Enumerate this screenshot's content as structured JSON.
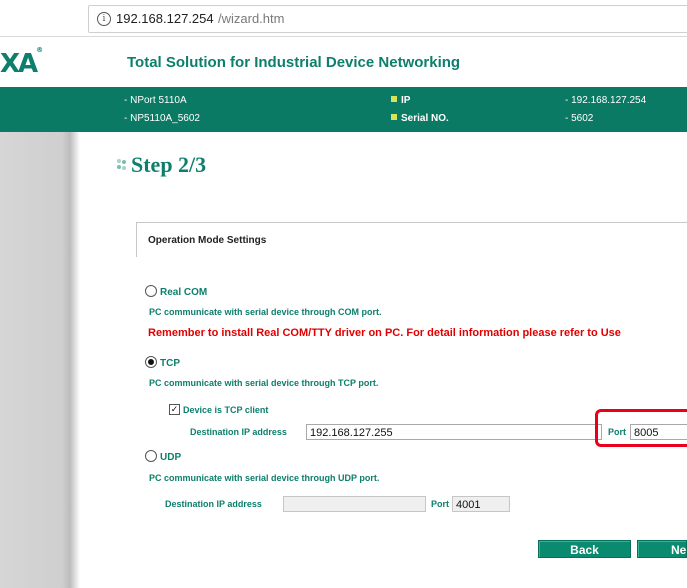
{
  "browser": {
    "url_host": "192.168.127.254",
    "url_path": "/wizard.htm",
    "info_icon": "info-icon"
  },
  "brand": {
    "logo_text": "XA",
    "logo_mark": "®",
    "tagline": "Total Solution for Industrial Device Networking",
    "accent_color": "#0a7a64"
  },
  "info_bar": {
    "model_name": "- NPort 5110A",
    "server_name": "- NP5110A_5602",
    "ip_label": "IP",
    "serial_label": "Serial NO.",
    "ip_value": "- 192.168.127.254",
    "serial_value": "- 5602"
  },
  "wizard": {
    "step_title": "Step 2/3",
    "section_heading": "Operation Mode Settings",
    "modes": {
      "real_com": {
        "label": "Real COM",
        "selected": false,
        "description": "PC communicate with serial device through COM port.",
        "warning": "Remember to install Real COM/TTY driver on PC. For detail information please refer to Use"
      },
      "tcp": {
        "label": "TCP",
        "selected": true,
        "description": "PC communicate with serial device through TCP port.",
        "client_checkbox_label": "Device is TCP client",
        "client_checked": true,
        "dest_ip_label": "Destination IP address",
        "dest_ip_value": "192.168.127.255",
        "port_label": "Port",
        "port_value": "8005"
      },
      "udp": {
        "label": "UDP",
        "selected": false,
        "description": "PC communicate with serial device through UDP port.",
        "dest_ip_label": "Destination IP address",
        "dest_ip_value": "",
        "port_label": "Port",
        "port_value": "4001"
      }
    },
    "buttons": {
      "back": "Back",
      "next": "Ne"
    },
    "highlight_color": "#e8001c"
  }
}
